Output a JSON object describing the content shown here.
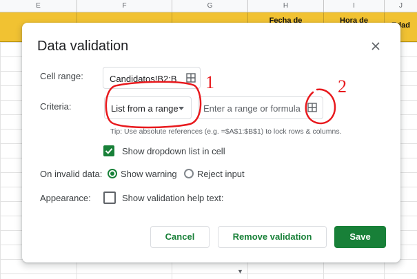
{
  "spreadsheet": {
    "columns": [
      "E",
      "F",
      "G",
      "H",
      "I",
      "J"
    ],
    "header_cells": [
      "",
      "",
      "",
      "Fecha de",
      "Hora de",
      "Edad"
    ]
  },
  "dialog": {
    "title": "Data validation",
    "close_icon": "close-icon",
    "cell_range": {
      "label": "Cell range:",
      "value": "Candidatos!B2:B",
      "icon": "grid-select-icon"
    },
    "criteria": {
      "label": "Criteria:",
      "selected": "List from a range",
      "range_placeholder": "Enter a range or formula",
      "icon": "grid-select-icon"
    },
    "tip": "Tip: Use absolute references (e.g. =$A$1:$B$1) to lock rows & columns.",
    "show_dropdown": {
      "label": "Show dropdown list in cell",
      "checked": true
    },
    "on_invalid": {
      "label": "On invalid data:",
      "options": [
        "Show warning",
        "Reject input"
      ],
      "selected": "Show warning"
    },
    "appearance": {
      "label": "Appearance:",
      "option_label": "Show validation help text:",
      "checked": false
    },
    "buttons": {
      "cancel": "Cancel",
      "remove": "Remove validation",
      "save": "Save"
    }
  },
  "annotations": [
    "1",
    "2"
  ],
  "colors": {
    "accent_green": "#188038",
    "header_yellow": "#f1c232",
    "annotation_red": "#e8191d"
  }
}
